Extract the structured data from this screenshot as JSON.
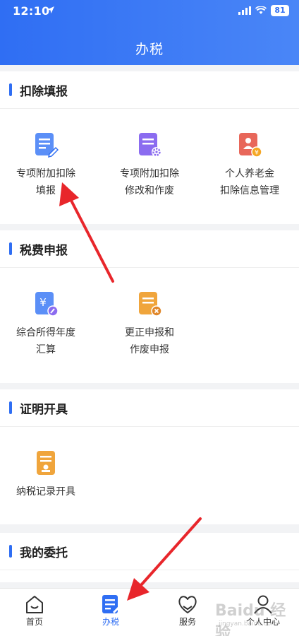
{
  "status_bar": {
    "time": "12:10",
    "battery": "81"
  },
  "header": {
    "title": "办税"
  },
  "sections": [
    {
      "title": "扣除填报",
      "items": [
        {
          "label_line1": "专项附加扣除",
          "label_line2": "填报",
          "icon": "document-edit-icon"
        },
        {
          "label_line1": "专项附加扣除",
          "label_line2": "修改和作废",
          "icon": "document-settings-icon"
        },
        {
          "label_line1": "个人养老金",
          "label_line2": "扣除信息管理",
          "icon": "pension-icon"
        }
      ]
    },
    {
      "title": "税费申报",
      "items": [
        {
          "label_line1": "综合所得年度",
          "label_line2": "汇算",
          "icon": "yuan-document-icon"
        },
        {
          "label_line1": "更正申报和",
          "label_line2": "作废申报",
          "icon": "document-cancel-icon"
        }
      ]
    },
    {
      "title": "证明开具",
      "items": [
        {
          "label_line1": "纳税记录开具",
          "label_line2": "",
          "icon": "certificate-icon"
        }
      ]
    },
    {
      "title": "我的委托",
      "items": []
    }
  ],
  "tabbar": {
    "items": [
      {
        "label": "首页",
        "icon": "home-icon",
        "active": false
      },
      {
        "label": "办税",
        "icon": "tax-document-icon",
        "active": true
      },
      {
        "label": "服务",
        "icon": "service-heart-icon",
        "active": false
      },
      {
        "label": "个人中心",
        "icon": "user-icon",
        "active": false
      }
    ]
  },
  "watermark": {
    "brand": "Baidu 经验",
    "url": "jingyan.baidu.com"
  },
  "colors": {
    "primary": "#2f6ef3",
    "annotation_arrow": "#e8262b",
    "orange": "#f0a53c",
    "purple": "#8b6cf0"
  }
}
